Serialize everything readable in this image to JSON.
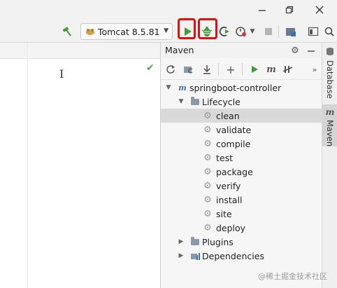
{
  "window": {
    "minimize_icon": "minimize-icon",
    "restore_icon": "restore-icon",
    "close_icon": "close-icon"
  },
  "toolbar": {
    "build_icon": "hammer-icon",
    "run_config": {
      "label": "Tomcat 8.5.81",
      "icon": "tomcat-icon"
    },
    "run_icon": "run-icon",
    "debug_icon": "debug-icon",
    "coverage_icon": "coverage-icon",
    "profile_icon": "profile-icon",
    "stop_icon": "stop-icon",
    "project_structure_icon": "project-structure-icon",
    "terminal_icon": "terminal-icon",
    "search_icon": "search-icon",
    "highlight_color": "#e01010"
  },
  "maven": {
    "title": "Maven",
    "tree": {
      "project": "springboot-controller",
      "lifecycle": "Lifecycle",
      "goals": [
        "clean",
        "validate",
        "compile",
        "test",
        "package",
        "verify",
        "install",
        "site",
        "deploy"
      ],
      "selected": "clean",
      "plugins": "Plugins",
      "dependencies": "Dependencies"
    }
  },
  "side_tabs": {
    "database": "Database",
    "maven": "Maven"
  },
  "watermark": "@稀土掘金技术社区"
}
